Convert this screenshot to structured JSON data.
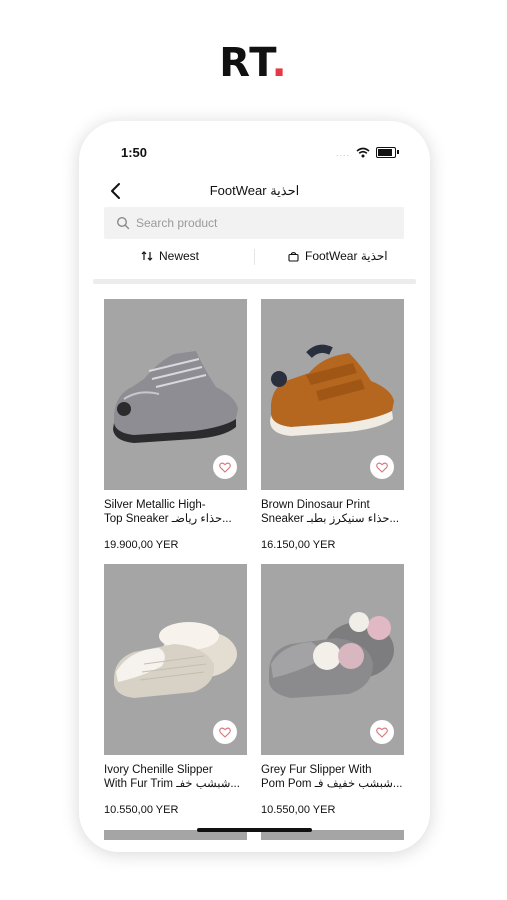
{
  "brand": {
    "text": "RT",
    "dot": ".",
    "dot_color": "#e63946"
  },
  "status_bar": {
    "time": "1:50",
    "signal": "....",
    "icons": [
      "wifi-icon",
      "battery-icon"
    ]
  },
  "header": {
    "title": "FootWear احذية",
    "back_icon": "chevron-left-icon"
  },
  "search": {
    "placeholder": "Search product",
    "icon": "search-icon"
  },
  "filters": {
    "sort_label": "Newest",
    "sort_icon": "sort-arrows-icon",
    "category_label": "FootWear احذية",
    "category_icon": "bag-icon"
  },
  "products": [
    {
      "name_line1": "Silver Metallic High-",
      "name_line2": "Top Sneaker حذاء رياضـ...",
      "price": "19.900,00 YER",
      "icon": "heart-icon"
    },
    {
      "name_line1": "Brown Dinosaur Print",
      "name_line2": "Sneaker حذاء سنيكرز بطبـ...",
      "price": "16.150,00 YER",
      "icon": "heart-icon"
    },
    {
      "name_line1": "Ivory Chenille Slipper",
      "name_line2": "With Fur Trim شبشب خفـ...",
      "price": "10.550,00 YER",
      "icon": "heart-icon"
    },
    {
      "name_line1": "Grey Fur Slipper With",
      "name_line2": "Pom Pom شبشب خفيف فـ...",
      "price": "10.550,00 YER",
      "icon": "heart-icon"
    }
  ],
  "colors": {
    "card_bg": "#a5a5a5",
    "search_bg": "#f2f2f2",
    "accent": "#e63946"
  }
}
